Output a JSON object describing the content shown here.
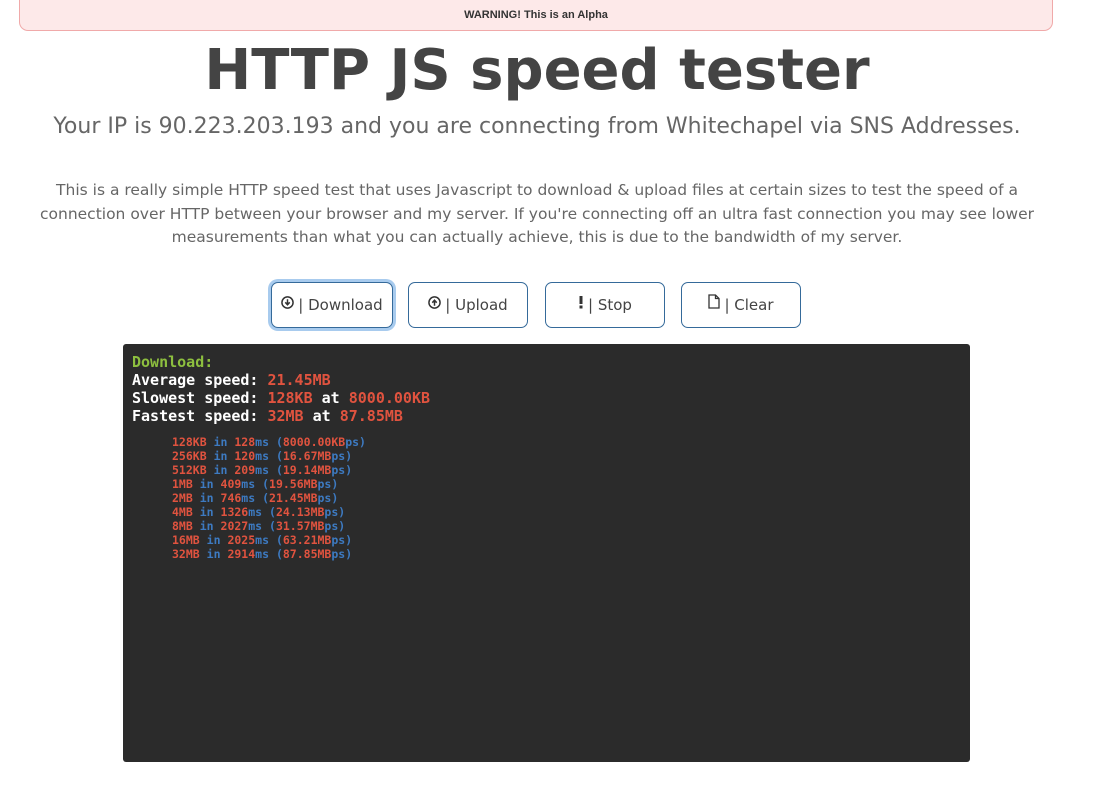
{
  "alert": {
    "text": "WARNING! This is an Alpha"
  },
  "header": {
    "title": "HTTP JS speed tester",
    "subtitle": "Your IP is 90.223.203.193 and you are connecting from Whitechapel via SNS Addresses."
  },
  "description": "This is a really simple HTTP speed test that uses Javascript to download & upload files at certain sizes to test the speed of a connection over HTTP between your browser and my server. If you're connecting off an ultra fast connection you may see lower measurements than what you can actually achieve, this is due to the bandwidth of my server.",
  "buttons": {
    "download": {
      "label": "| Download",
      "icon": "download-circle-icon"
    },
    "upload": {
      "label": "| Upload",
      "icon": "upload-circle-icon"
    },
    "stop": {
      "label": "| Stop",
      "icon": "exclamation-icon"
    },
    "clear": {
      "label": "| Clear",
      "icon": "document-icon"
    }
  },
  "terminal": {
    "heading": "Download:",
    "average_label": "Average speed:",
    "average_value": "21.45MB",
    "slowest_label": "Slowest speed:",
    "slowest_value": "128KB",
    "slowest_at": "at",
    "slowest_speed": "8000.00KB",
    "fastest_label": "Fastest speed:",
    "fastest_value": "32MB",
    "fastest_at": "at",
    "fastest_speed": "87.85MB",
    "in_word": "in",
    "ms_unit": "ms",
    "ps_unit": "ps",
    "results": [
      {
        "size": "128KB",
        "time": "128",
        "speed": "8000.00KB"
      },
      {
        "size": "256KB",
        "time": "120",
        "speed": "16.67MB"
      },
      {
        "size": "512KB",
        "time": "209",
        "speed": "19.14MB"
      },
      {
        "size": "1MB",
        "time": "409",
        "speed": "19.56MB"
      },
      {
        "size": "2MB",
        "time": "746",
        "speed": "21.45MB"
      },
      {
        "size": "4MB",
        "time": "1326",
        "speed": "24.13MB"
      },
      {
        "size": "8MB",
        "time": "2027",
        "speed": "31.57MB"
      },
      {
        "size": "16MB",
        "time": "2025",
        "speed": "63.21MB"
      },
      {
        "size": "32MB",
        "time": "2914",
        "speed": "87.85MB"
      }
    ]
  },
  "colors": {
    "accent_border": "#356a9a",
    "terminal_bg": "#2b2b2b",
    "terminal_green": "#8dbf3f",
    "terminal_red": "#e0533f",
    "terminal_blue": "#3d7ac1",
    "alert_bg": "#fde9e9"
  }
}
